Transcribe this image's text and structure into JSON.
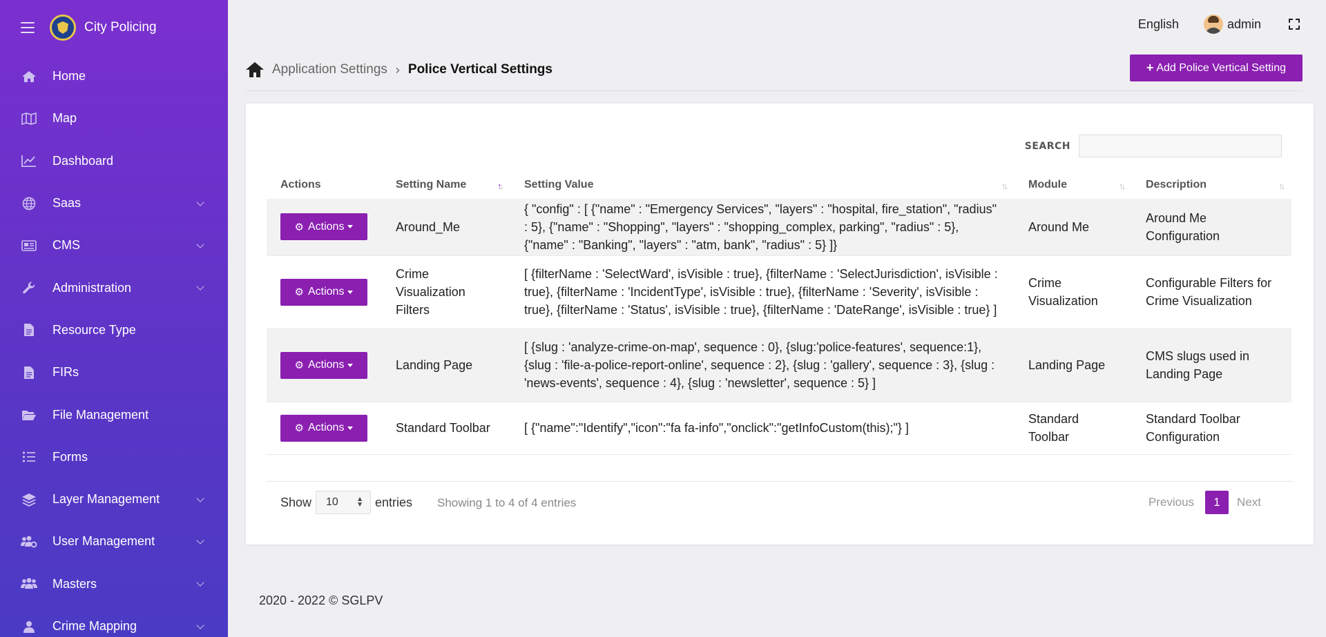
{
  "brand": {
    "name": "City Policing"
  },
  "sidebar": {
    "items": [
      {
        "label": "Home",
        "icon": "home-icon",
        "has_children": false
      },
      {
        "label": "Map",
        "icon": "map-icon",
        "has_children": false
      },
      {
        "label": "Dashboard",
        "icon": "chart-line-icon",
        "has_children": false
      },
      {
        "label": "Saas",
        "icon": "globe-icon",
        "has_children": true
      },
      {
        "label": "CMS",
        "icon": "newspaper-icon",
        "has_children": true
      },
      {
        "label": "Administration",
        "icon": "wrench-icon",
        "has_children": true
      },
      {
        "label": "Resource Type",
        "icon": "file-icon",
        "has_children": false
      },
      {
        "label": "FIRs",
        "icon": "file-icon",
        "has_children": false
      },
      {
        "label": "File Management",
        "icon": "folder-open-icon",
        "has_children": false
      },
      {
        "label": "Forms",
        "icon": "list-icon",
        "has_children": false
      },
      {
        "label": "Layer Management",
        "icon": "layers-icon",
        "has_children": true
      },
      {
        "label": "User Management",
        "icon": "users-cog-icon",
        "has_children": true
      },
      {
        "label": "Masters",
        "icon": "users-icon",
        "has_children": true
      },
      {
        "label": "Crime Mapping",
        "icon": "user-icon",
        "has_children": true
      }
    ]
  },
  "topbar": {
    "language": "English",
    "username": "admin"
  },
  "breadcrumb": {
    "parent": "Application Settings",
    "current": "Police Vertical Settings"
  },
  "add_button": {
    "label": "Add Police Vertical Setting"
  },
  "search": {
    "label": "SEARCH",
    "value": ""
  },
  "table": {
    "columns": [
      "Actions",
      "Setting Name",
      "Setting Value",
      "Module",
      "Description"
    ],
    "action_label": "Actions",
    "rows": [
      {
        "name": "Around_Me",
        "value": "{ \"config\" : [ {\"name\" : \"Emergency Services\", \"layers\" : \"hospital, fire_station\", \"radius\" : 5}, {\"name\" : \"Shopping\", \"layers\" : \"shopping_complex, parking\", \"radius\" : 5}, {\"name\" : \"Banking\", \"layers\" : \"atm, bank\", \"radius\" : 5} ]}",
        "module": "Around Me",
        "description": "Around Me Configuration"
      },
      {
        "name": "Crime Visualization Filters",
        "value": "[ {filterName : 'SelectWard', isVisible : true}, {filterName : 'SelectJurisdiction', isVisible : true}, {filterName : 'IncidentType', isVisible : true}, {filterName : 'Severity', isVisible : true}, {filterName : 'Status', isVisible : true}, {filterName : 'DateRange', isVisible : true} ]",
        "module": "Crime Visualization",
        "description": "Configurable Filters for Crime Visualization"
      },
      {
        "name": "Landing Page",
        "value": "[ {slug : 'analyze-crime-on-map', sequence : 0}, {slug:'police-features', sequence:1}, {slug : 'file-a-police-report-online', sequence : 2}, {slug : 'gallery', sequence : 3}, {slug : 'news-events', sequence : 4}, {slug : 'newsletter', sequence : 5} ]",
        "module": "Landing Page",
        "description": "CMS slugs used in Landing Page"
      },
      {
        "name": "Standard Toolbar",
        "value": "[ {\"name\":\"Identify\",\"icon\":\"fa fa-info\",\"onclick\":\"getInfoCustom(this);\"} ]",
        "module": "Standard Toolbar",
        "description": "Standard Toolbar Configuration"
      }
    ]
  },
  "length": {
    "show": "Show",
    "value": "10",
    "entries": "entries"
  },
  "info": "Showing 1 to 4 of 4 entries",
  "pagination": {
    "previous": "Previous",
    "page": "1",
    "next": "Next"
  },
  "footer": {
    "copyright": "2020 - 2022 © SGLPV"
  },
  "colors": {
    "accent": "#8a1fb0",
    "sidebar_top": "#7b2fcf",
    "sidebar_bottom": "#4a3bc4"
  }
}
